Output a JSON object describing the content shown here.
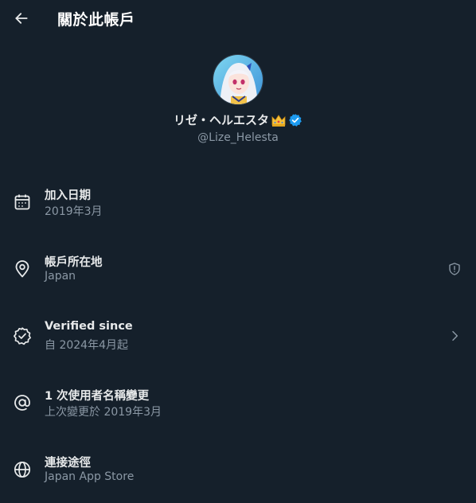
{
  "header": {
    "title": "關於此帳戶"
  },
  "profile": {
    "display_name": "リゼ・ヘルエスタ",
    "handle": "@Lize_Helesta",
    "verified_color": "#1d9bf0"
  },
  "rows": [
    {
      "icon": "calendar-icon",
      "title": "加入日期",
      "subtitle": "2019年3月"
    },
    {
      "icon": "location-pin-icon",
      "title": "帳戶所在地",
      "subtitle": "Japan",
      "trailing": "shield-alert-icon"
    },
    {
      "icon": "verified-badge-icon",
      "title": "Verified since",
      "subtitle": "自 2024年4月起",
      "trailing": "chevron-right-icon"
    },
    {
      "icon": "at-sign-icon",
      "title": "1 次使用者名稱變更",
      "subtitle": "上次變更於 2019年3月"
    },
    {
      "icon": "globe-icon",
      "title": "連接途徑",
      "subtitle": "Japan App Store"
    }
  ]
}
